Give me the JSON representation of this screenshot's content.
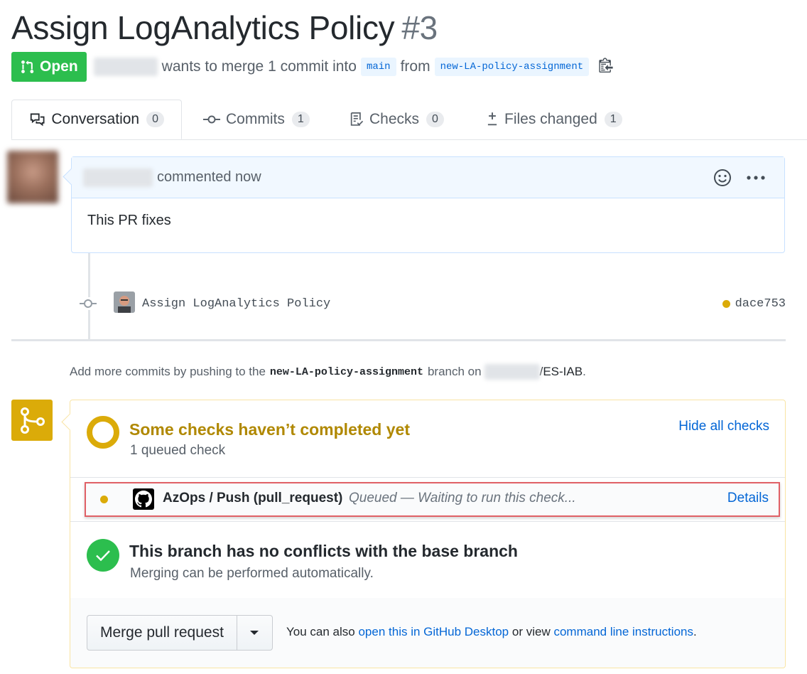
{
  "pr": {
    "title": "Assign LogAnalytics Policy",
    "number": "#3",
    "state": "Open",
    "merge_text": "wants to merge 1 commit into",
    "base_branch": "main",
    "from_text": "from",
    "head_branch": "new-LA-policy-assignment"
  },
  "tabs": [
    {
      "label": "Conversation",
      "count": "0",
      "icon": "comment-discussion-icon"
    },
    {
      "label": "Commits",
      "count": "1",
      "icon": "git-commit-icon"
    },
    {
      "label": "Checks",
      "count": "0",
      "icon": "checklist-icon"
    },
    {
      "label": "Files changed",
      "count": "1",
      "icon": "diff-icon"
    }
  ],
  "comment": {
    "action": "commented now",
    "body": "This PR fixes"
  },
  "commit": {
    "message": "Assign LogAnalytics Policy",
    "sha": "dace753"
  },
  "push_hint": {
    "prefix": "Add more commits by pushing to the",
    "branch": "new-LA-policy-assignment",
    "middle": "branch on",
    "repo": "/ES-IAB",
    "suffix": "."
  },
  "checks": {
    "title": "Some checks haven’t completed yet",
    "subtitle": "1 queued check",
    "hide_label": "Hide all checks",
    "item": {
      "name": "AzOps / Push (pull_request)",
      "status": "Queued — Waiting to run this check...",
      "details": "Details"
    }
  },
  "conflicts": {
    "title": "This branch has no conflicts with the base branch",
    "subtitle": "Merging can be performed automatically."
  },
  "merge": {
    "button_label": "Merge pull request",
    "hint_prefix": "You can also",
    "desktop_link": "open this in GitHub Desktop",
    "hint_middle": "or view",
    "cli_link": "command line instructions",
    "hint_suffix": "."
  },
  "colors": {
    "open_green": "#2cbe4e",
    "pending_yellow": "#dbab09",
    "link_blue": "#0366d6",
    "highlight_red": "#e06066"
  }
}
